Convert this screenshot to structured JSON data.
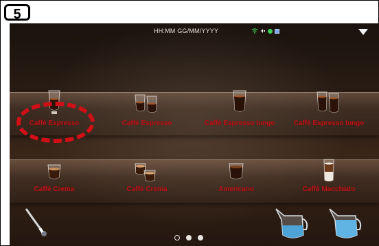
{
  "step": {
    "number": "5"
  },
  "status_bar": {
    "datetime": "HH:MM GG/MM/YYYY"
  },
  "products_top": [
    {
      "label": "Caffè Espresso",
      "icon": "espresso-cup-icon"
    },
    {
      "label": "Caffè Espresso",
      "icon": "double-espresso-icon"
    },
    {
      "label": "Caffè Espresso lungo",
      "icon": "espresso-lungo-icon"
    },
    {
      "label": "Caffè Espresso lungo",
      "icon": "double-espresso-lungo-icon"
    }
  ],
  "products_bottom": [
    {
      "label": "Caffè Crema",
      "icon": "crema-cup-icon"
    },
    {
      "label": "Caffè Crema",
      "icon": "double-crema-icon"
    },
    {
      "label": "Americano",
      "icon": "americano-cup-icon"
    },
    {
      "label": "Caffè Macchiato",
      "icon": "macchiato-glass-icon"
    }
  ],
  "pager": {
    "page_count": 3,
    "active_page": 1
  },
  "colors": {
    "highlight": "#d20f17",
    "label": "#b8151a",
    "status_green": "#3fcf55"
  }
}
